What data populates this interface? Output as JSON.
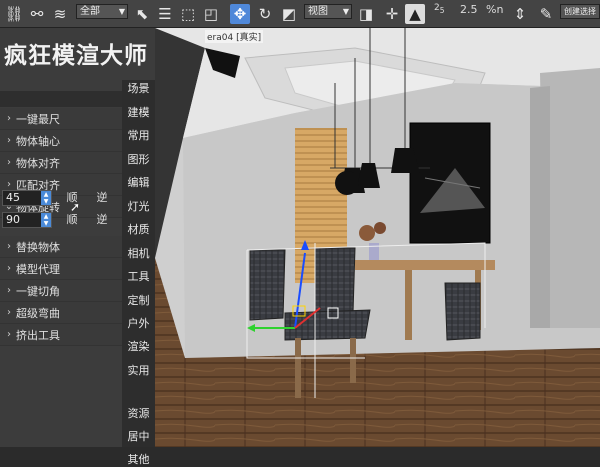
{
  "toolbar": {
    "selection_filter": "全部",
    "coord_system": "视图",
    "snap_angle": "2.5",
    "snap_percent": "%n",
    "named_selection": "创建选择"
  },
  "brand": "疯狂模渲大师",
  "menu_top": [
    {
      "label": "一键最尺"
    },
    {
      "label": "物体轴心"
    },
    {
      "label": "物体对齐"
    },
    {
      "label": "匹配对齐"
    },
    {
      "label": "物体旋转"
    }
  ],
  "rotate": {
    "value1": "45",
    "value2": "90",
    "cw": "顺",
    "ccw": "逆"
  },
  "menu_bottom": [
    {
      "label": "替换物体"
    },
    {
      "label": "模型代理"
    },
    {
      "label": "一键切角"
    },
    {
      "label": "超级弯曲"
    },
    {
      "label": "挤出工具"
    }
  ],
  "tabs": [
    "场景",
    "建模",
    "常用",
    "图形",
    "编辑",
    "灯光",
    "材质",
    "相机",
    "工具",
    "定制",
    "户外",
    "渲染",
    "实用",
    "资源",
    "居中",
    "其他"
  ],
  "viewport": {
    "label": "era04 [真实]"
  },
  "colors": {
    "accent": "#4f88d9",
    "panel_bg": "#3c3c3c",
    "toolbar_bg": "#444444"
  }
}
